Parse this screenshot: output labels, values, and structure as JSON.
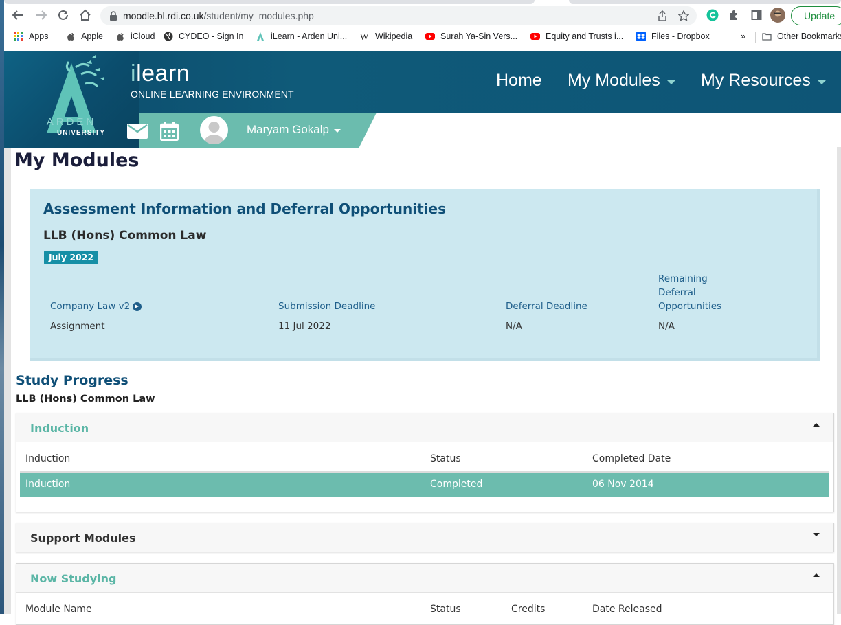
{
  "browser": {
    "url_host": "moodle.bl.rdi.co.uk",
    "url_path": "/student/my_modules.php",
    "update_label": "Update",
    "bookmarks": [
      {
        "label": "Apps",
        "icon": "apps-grid-icon"
      },
      {
        "label": "Apple",
        "icon": "apple-icon"
      },
      {
        "label": "iCloud",
        "icon": "apple-icon"
      },
      {
        "label": "CYDEO - Sign In",
        "icon": "globe-icon"
      },
      {
        "label": "iLearn - Arden Uni...",
        "icon": "ilearn-icon"
      },
      {
        "label": "Wikipedia",
        "icon": "wikipedia-icon"
      },
      {
        "label": "Surah Ya-Sin Vers...",
        "icon": "youtube-icon"
      },
      {
        "label": "Equity and Trusts i...",
        "icon": "youtube-icon"
      },
      {
        "label": "Files - Dropbox",
        "icon": "dropbox-icon"
      }
    ],
    "overflow_label": "»",
    "other_bookmarks": "Other Bookmarks"
  },
  "site": {
    "brand_i": "i",
    "brand_rest": "learn",
    "brand_sub": "ONLINE LEARNING ENVIRONMENT",
    "logo_word1": "ARDEN",
    "logo_word2": "UNIVERSITY",
    "nav": {
      "home": "Home",
      "my_modules": "My Modules",
      "my_resources": "My Resources"
    },
    "user_name": "Maryam Gokalp",
    "colors": {
      "header": "#0e5576",
      "teal": "#6bbcae",
      "panel": "#cce8f0",
      "link": "#1f5f8b"
    }
  },
  "page": {
    "title": "My Modules"
  },
  "assessment": {
    "heading": "Assessment Information and Deferral Opportunities",
    "program": "LLB (Hons) Common Law",
    "badge": "July 2022",
    "columns": {
      "module": "Company Law v2",
      "submission": "Submission Deadline",
      "deferral": "Deferral Deadline",
      "remaining_1": "Remaining",
      "remaining_2": "Deferral",
      "remaining_3": "Opportunities"
    },
    "row": {
      "type": "Assignment",
      "submission": "11 Jul 2022",
      "deferral": "N/A",
      "remaining": "N/A"
    }
  },
  "study": {
    "title": "Study Progress",
    "program": "LLB (Hons) Common Law",
    "induction": {
      "title": "Induction",
      "headers": {
        "name": "Induction",
        "status": "Status",
        "date": "Completed Date"
      },
      "row": {
        "name": "Induction",
        "status": "Completed",
        "date": "06 Nov 2014"
      }
    },
    "support": {
      "title": "Support Modules"
    },
    "now": {
      "title": "Now Studying",
      "headers": {
        "name": "Module Name",
        "status": "Status",
        "credits": "Credits",
        "date": "Date Released"
      }
    }
  }
}
